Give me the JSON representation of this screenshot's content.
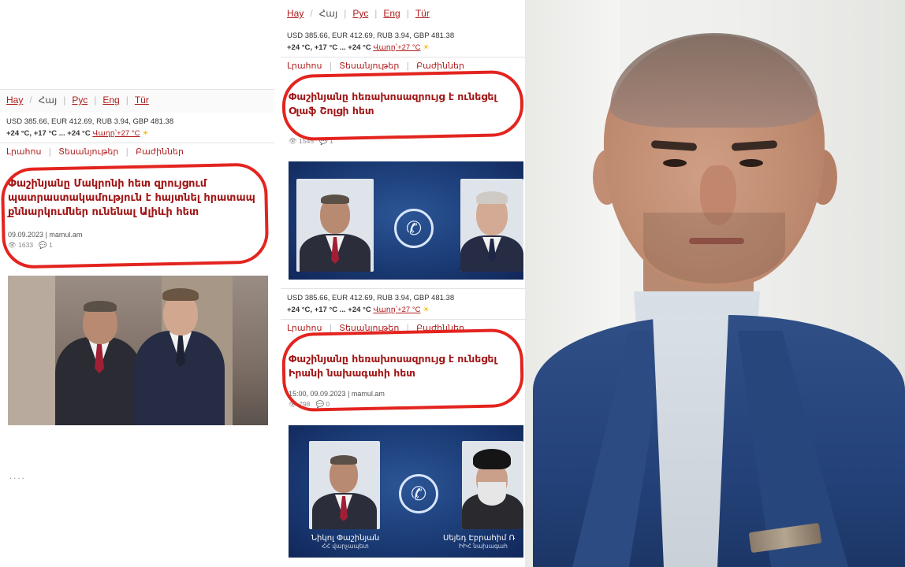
{
  "top_screenshot": {
    "languages": [
      {
        "label": "Hay",
        "current": false
      },
      {
        "label": "Հայ",
        "current": true
      },
      {
        "label": "Рус",
        "current": false
      },
      {
        "label": "Eng",
        "current": false
      },
      {
        "label": "Tür",
        "current": false
      }
    ],
    "rates_line": "USD 385.66, EUR 412.69, RUB 3.94, GBP 481.38",
    "weather_line": "+24 °C, +17 °C ... +24 °C",
    "weather_tomorrow": "Վաղը՝+27 °C",
    "nav": [
      "Լրահոս",
      "Տեսանյութեր",
      "Բաժիններ"
    ]
  },
  "articles": [
    {
      "headline": "Փաշինյանը Մակրոնի հետ զրույցում պատրաստակամություն է հայտնել հրատապ քննարկումներ ունենալ Ալիևի հետ",
      "meta": "09.09.2023 | mamul.am",
      "views": "1633",
      "comments": "1"
    },
    {
      "headline": "Փաշինյանը հեռախոսազրույց է ունեցել Օլաֆ Շոլցի հետ",
      "meta": "",
      "views": "1545",
      "comments": "1"
    },
    {
      "headline": "Փաշինյանը հեռախոսազրույց է ունեցել Իրանի նախագահի հետ",
      "meta": "15:00, 09.09.2023 | mamul.am",
      "views": "798",
      "comments": "0"
    }
  ],
  "captions": {
    "left_name": "Նիկոլ Փաշինյան",
    "left_title": "ՀՀ վարչապետ",
    "right_name": "Սեյեդ Էբրահիմ Ռ",
    "right_title": "ԻԻՀ նախագահ"
  },
  "colors": {
    "accent_red": "#a01616",
    "marker_red": "#e3241f",
    "call_blue": "#1b3c76",
    "suit_blue": "#2f4f86"
  },
  "icons": [
    "eye-icon",
    "comment-icon",
    "phone-call-icon",
    "sun-icon"
  ]
}
